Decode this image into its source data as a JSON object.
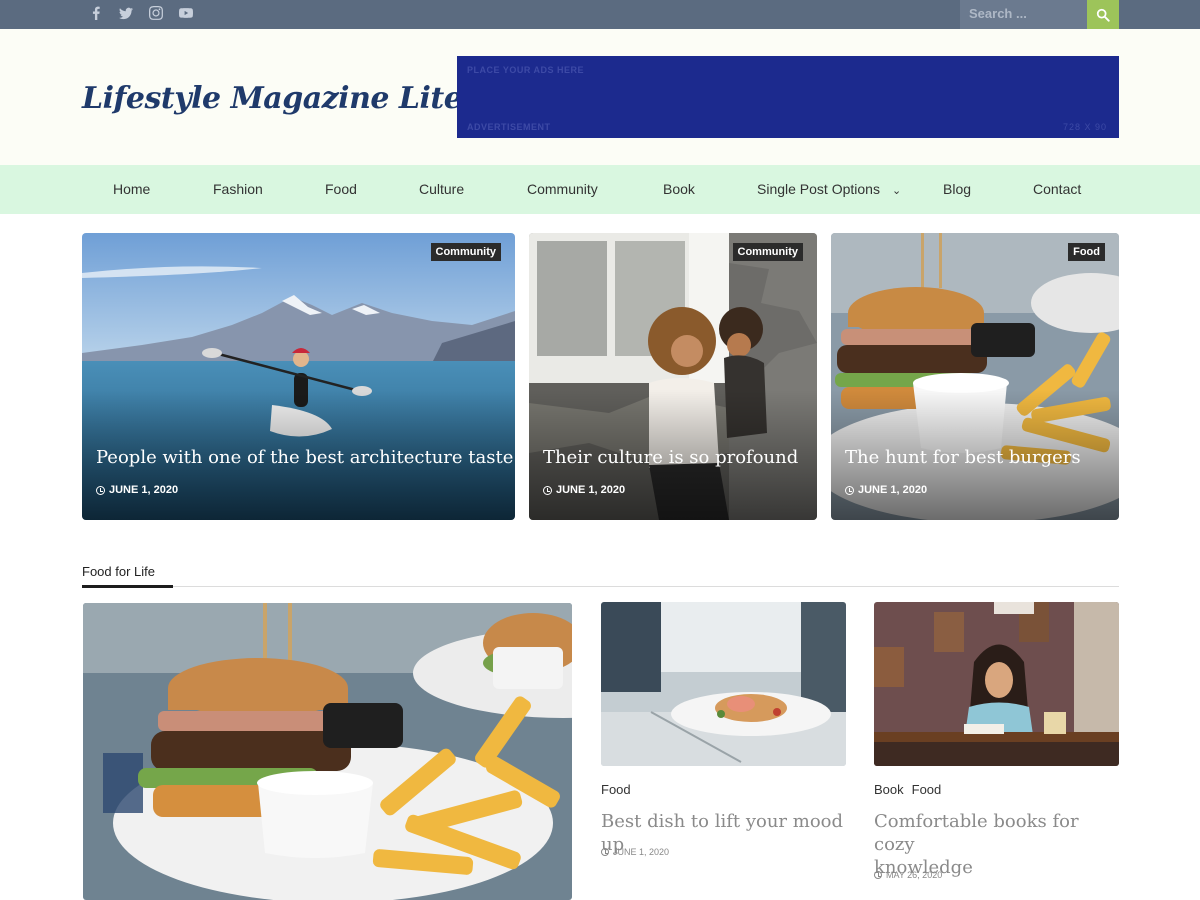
{
  "topbar": {
    "social_icons": [
      "facebook-icon",
      "twitter-icon",
      "instagram-icon",
      "youtube-icon"
    ],
    "search_placeholder": "Search ...",
    "search_button_color": "#9dc45a"
  },
  "header": {
    "site_title": "Lifestyle Magazine Lite",
    "ad": {
      "top_text": "PLACE YOUR ADS HERE",
      "bottom_text": "ADVERTISEMENT",
      "size_text": "728 X 90",
      "color": "#1c2a8e"
    }
  },
  "nav": {
    "items": [
      {
        "label": "Home"
      },
      {
        "label": "Fashion"
      },
      {
        "label": "Food"
      },
      {
        "label": "Culture"
      },
      {
        "label": "Community"
      },
      {
        "label": "Book"
      },
      {
        "label": "Single Post Options",
        "has_dropdown": true
      },
      {
        "label": "Blog"
      },
      {
        "label": "Contact"
      }
    ]
  },
  "hero": [
    {
      "tag": "Community",
      "title": "People with one of the best architecture taste",
      "date": "JUNE 1, 2020"
    },
    {
      "tag": "Community",
      "title": "Their culture is so profound",
      "date": "JUNE 1, 2020"
    },
    {
      "tag": "Food",
      "title": "The hunt for best burgers",
      "date": "JUNE 1, 2020"
    }
  ],
  "section": {
    "title": "Food for Life",
    "posts": [
      {
        "categories": [
          "Food"
        ],
        "title": "Best dish to lift your mood up",
        "date": "JUNE 1, 2020"
      },
      {
        "categories": [
          "Book",
          "Food"
        ],
        "title_line1": "Comfortable books for cozy",
        "title_line2": "knowledge",
        "date": "MAY 26, 2020"
      }
    ]
  }
}
